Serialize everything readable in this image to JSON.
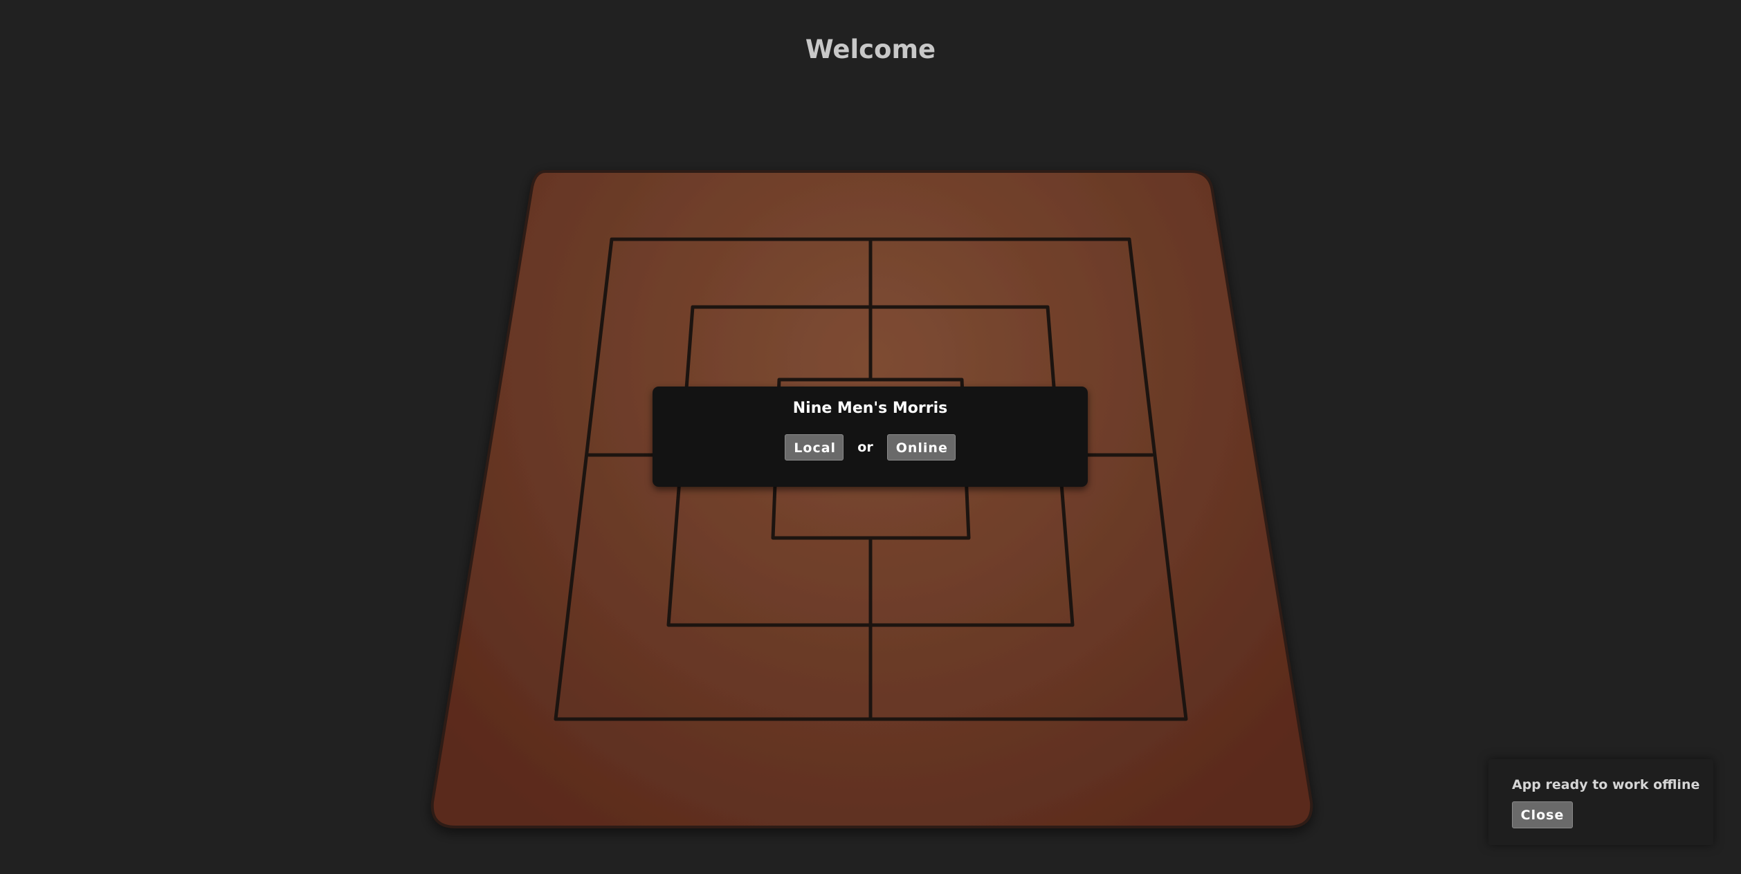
{
  "header": {
    "title": "Welcome"
  },
  "board": {
    "name": "nine-mens-morris-board",
    "wood_color_center": "#7a4a32",
    "wood_color_edge": "#5a2b1d",
    "line_color": "#1c1410"
  },
  "menu": {
    "title": "Nine Men's Morris",
    "local_label": "Local",
    "separator": "or",
    "online_label": "Online"
  },
  "toast": {
    "message": "App ready to work offline",
    "close_label": "Close"
  }
}
